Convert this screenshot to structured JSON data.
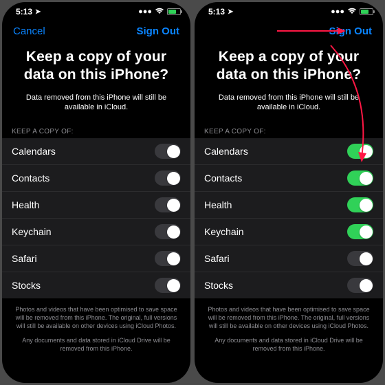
{
  "status": {
    "time": "5:13",
    "location_icon": "➤"
  },
  "nav": {
    "cancel": "Cancel",
    "signout": "Sign Out"
  },
  "title": "Keep a copy of your data on this iPhone?",
  "subtitle": "Data removed from this iPhone will still be available in iCloud.",
  "section_header": "KEEP A COPY OF:",
  "items": [
    {
      "label": "Calendars"
    },
    {
      "label": "Contacts"
    },
    {
      "label": "Health"
    },
    {
      "label": "Keychain"
    },
    {
      "label": "Safari"
    },
    {
      "label": "Stocks"
    }
  ],
  "left_states": [
    false,
    false,
    false,
    false,
    false,
    false
  ],
  "right_states": [
    true,
    true,
    true,
    true,
    false,
    false
  ],
  "footer1": "Photos and videos that have been optimised to save space will be removed from this iPhone. The original, full versions will still be available on other devices using iCloud Photos.",
  "footer2": "Any documents and data stored in iCloud Drive will be removed from this iPhone."
}
